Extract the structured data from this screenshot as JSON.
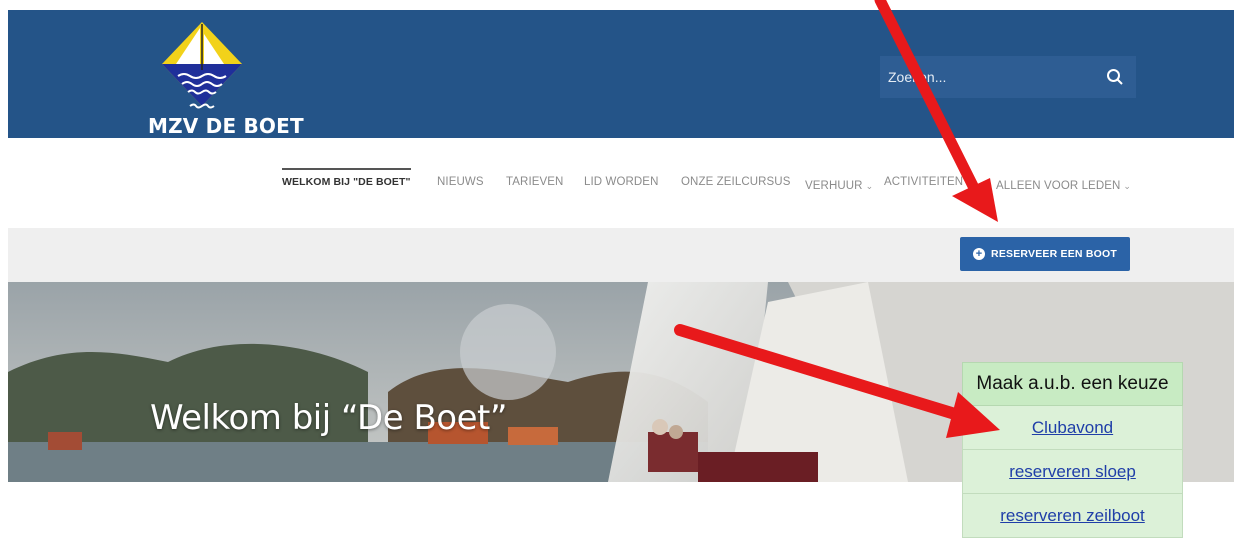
{
  "header": {
    "brand": "MZV DE BOET",
    "search": {
      "placeholder": "Zoeken..."
    }
  },
  "nav": {
    "items": [
      {
        "label": "WELKOM BIJ \"DE BOET\"",
        "active": true
      },
      {
        "label": "NIEUWS"
      },
      {
        "label": "TARIEVEN"
      },
      {
        "label": "LID WORDEN"
      },
      {
        "label": "ONZE ZEILCURSUS"
      },
      {
        "label": "VERHUUR",
        "dropdown": true
      },
      {
        "label": "ACTIVITEITEN"
      },
      {
        "label": "ALLEEN VOOR LEDEN",
        "dropdown": true
      }
    ]
  },
  "action_bar": {
    "reserve_label": "RESERVEER EEN BOOT"
  },
  "hero": {
    "title": "Welkom bij “De Boet”"
  },
  "choice_box": {
    "heading": "Maak a.u.b. een keuze",
    "options": [
      "Clubavond",
      "reserveren sloep",
      "reserveren zeilboot"
    ]
  },
  "colors": {
    "header_bg": "#245488",
    "button_bg": "#2b63a7",
    "arrow": "#e8191b",
    "choice_bg": "#dcf1d8"
  }
}
